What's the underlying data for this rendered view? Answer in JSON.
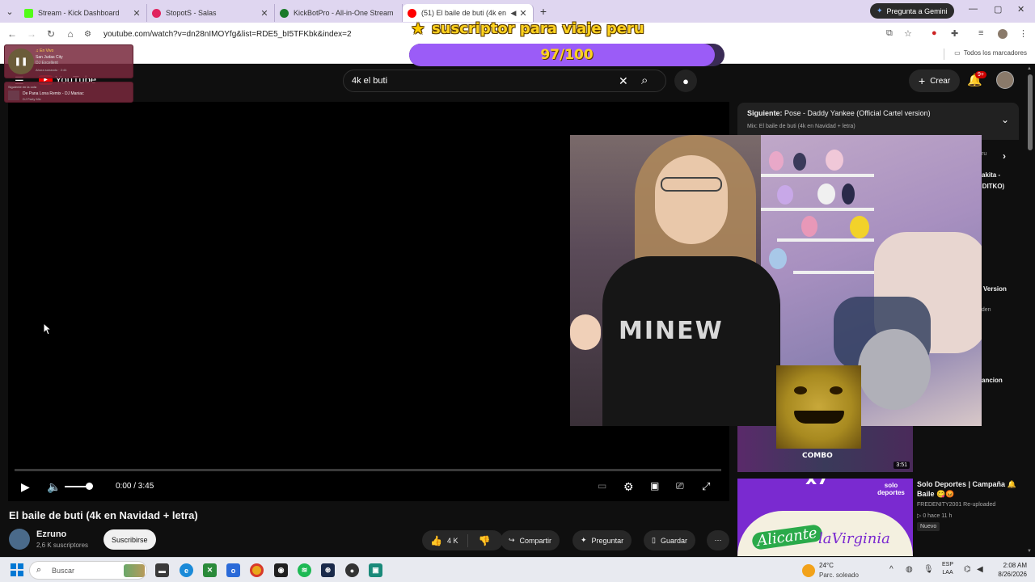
{
  "browser": {
    "tabs": [
      {
        "title": "Stream - Kick Dashboard",
        "favicon_color": "#53fc18"
      },
      {
        "title": "StopotS - Salas",
        "favicon_color": "#e0245e"
      },
      {
        "title": "KickBotPro - All-in-One Stream",
        "favicon_color": "#1a7a2a"
      },
      {
        "title": "(51) El baile de buti (4k en",
        "favicon_color": "#ff0000"
      }
    ],
    "gemini_label": "Pregunta a Gemini",
    "url": "youtube.com/watch?v=dn28nIMOYfg&list=RDE5_bI5TFKbk&index=2",
    "bookmarks_all": "Todos los marcadores"
  },
  "overlay": {
    "goal_title": "suscriptor para viaje peru",
    "goal_progress_text": "97/100",
    "goal_fraction": 0.97,
    "goal_color": "#9b5cf7"
  },
  "spotify": {
    "widget1": {
      "line1": "♫ En Vivo",
      "line2": "San Judas City",
      "line3": "DJ Excellent",
      "line4": "Ahora sonando · 2:44"
    },
    "widget2": {
      "line1": "Siguiente en la cola",
      "line2": "De Pana Lona Remix - DJ Maniac",
      "line3": "DJ Party Mix"
    }
  },
  "youtube": {
    "logo_text": "YouTube",
    "search_query": "4k el buti",
    "create_label": "Crear",
    "notif_badge": "9+",
    "player": {
      "time": "0:00 / 3:45",
      "progress_fraction": 0.0,
      "volume_fraction": 1.0
    },
    "video_title": "El baile de buti (4k en Navidad + letra)",
    "channel_name": "Ezruno",
    "channel_subs": "2,6 K suscriptores",
    "subscribe_label": "Suscribirse",
    "likes": "4 K",
    "share_label": "Compartir",
    "ask_label": "Preguntar",
    "save_label": "Guardar",
    "next": {
      "prefix": "Siguiente:",
      "title": "Pose - Daddy Yankee (Official Cartel version)",
      "mix": "Mix: El baile de buti (4k en Navidad + letra)"
    },
    "side_fragments": [
      "akita -",
      "y DITKO)",
      "D Version",
      "eden",
      "ancion",
      "ru"
    ],
    "thumb1": {
      "overlay_text": "COMBO",
      "duration": "3:51"
    },
    "thumb2": {
      "x7": "x7",
      "solo": "solo deportes",
      "ali": "Alicante",
      "vir": "laVirginia"
    },
    "related": {
      "title": "Solo Deportes | Campaña 🔔 Baile 😋😡",
      "channel": "FREDENITY2001 Re-uploaded",
      "meta": "▷ 0 hace 11 h",
      "badge": "Nuevo"
    }
  },
  "webcam": {
    "shirt_text": "MINEW"
  },
  "taskbar": {
    "search_placeholder": "Buscar",
    "weather_temp": "24°C",
    "weather_desc": "Parc. soleado",
    "lang_1": "ESP",
    "lang_2": "LAA",
    "time": "2:08 AM",
    "date": "8/26/2026"
  }
}
